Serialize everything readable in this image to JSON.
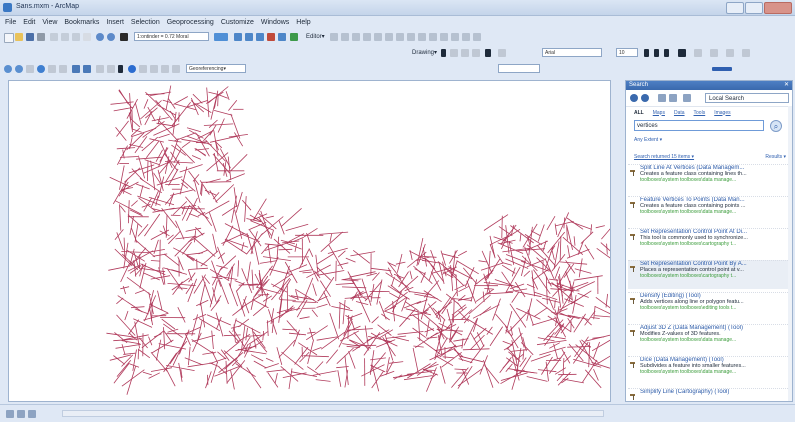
{
  "window": {
    "title": "Sans.mxm - ArcMap"
  },
  "menu": [
    "File",
    "Edit",
    "View",
    "Bookmarks",
    "Insert",
    "Selection",
    "Geoprocessing",
    "Customize",
    "Windows",
    "Help"
  ],
  "toolbar": {
    "scale": "1:ontinder = 0.72 Moral",
    "editor": "Editor▾",
    "drawing": "Drawing▾",
    "font": "Arial",
    "font_size": "10",
    "georeferencing": "Georeferencing▾"
  },
  "search": {
    "header": "Search",
    "location": "Local Search",
    "tabs": [
      "ALL",
      "Maps",
      "Data",
      "Tools",
      "Images"
    ],
    "query": "vertices",
    "any_extent": "Any Extent ▾",
    "sort": "Search returned 15 items ▾",
    "results_label": "Results ▾",
    "results": [
      {
        "title": "Split Line At Vertices (Data Managem...",
        "desc": "Creates a feature class containing lines th...",
        "path": "toolboxes\\system toolboxes\\data manage..."
      },
      {
        "title": "Feature Vertices To Points (Data Man...",
        "desc": "Creates a feature class containing points ...",
        "path": "toolboxes\\system toolboxes\\data manage..."
      },
      {
        "title": "Set Representation Control Point At Di...",
        "desc": "This tool is commonly used to synchronize...",
        "path": "toolboxes\\system toolboxes\\cartography t..."
      },
      {
        "title": "Set Representation Control Point By A...",
        "desc": "Places a representation control point at v...",
        "path": "toolboxes\\system toolboxes\\cartography t..."
      },
      {
        "title": "Densify (Editing) (Tool)",
        "desc": "Adds vertices along line or polygon featu...",
        "path": "toolboxes\\system toolboxes\\editing tools t..."
      },
      {
        "title": "Adjust 3D Z (Data Management) (Tool)",
        "desc": "Modifies Z-values of 3D features.",
        "path": "toolboxes\\system toolboxes\\data manage..."
      },
      {
        "title": "Dice (Data Management) (Tool)",
        "desc": "Subdivides a feature into smaller features...",
        "path": "toolboxes\\system toolboxes\\data manage..."
      },
      {
        "title": "Simplify Line (Cartography) (Tool)",
        "desc": "",
        "path": ""
      }
    ]
  },
  "colors": {
    "line": "#b03a5b",
    "accent": "#3a69ad"
  }
}
